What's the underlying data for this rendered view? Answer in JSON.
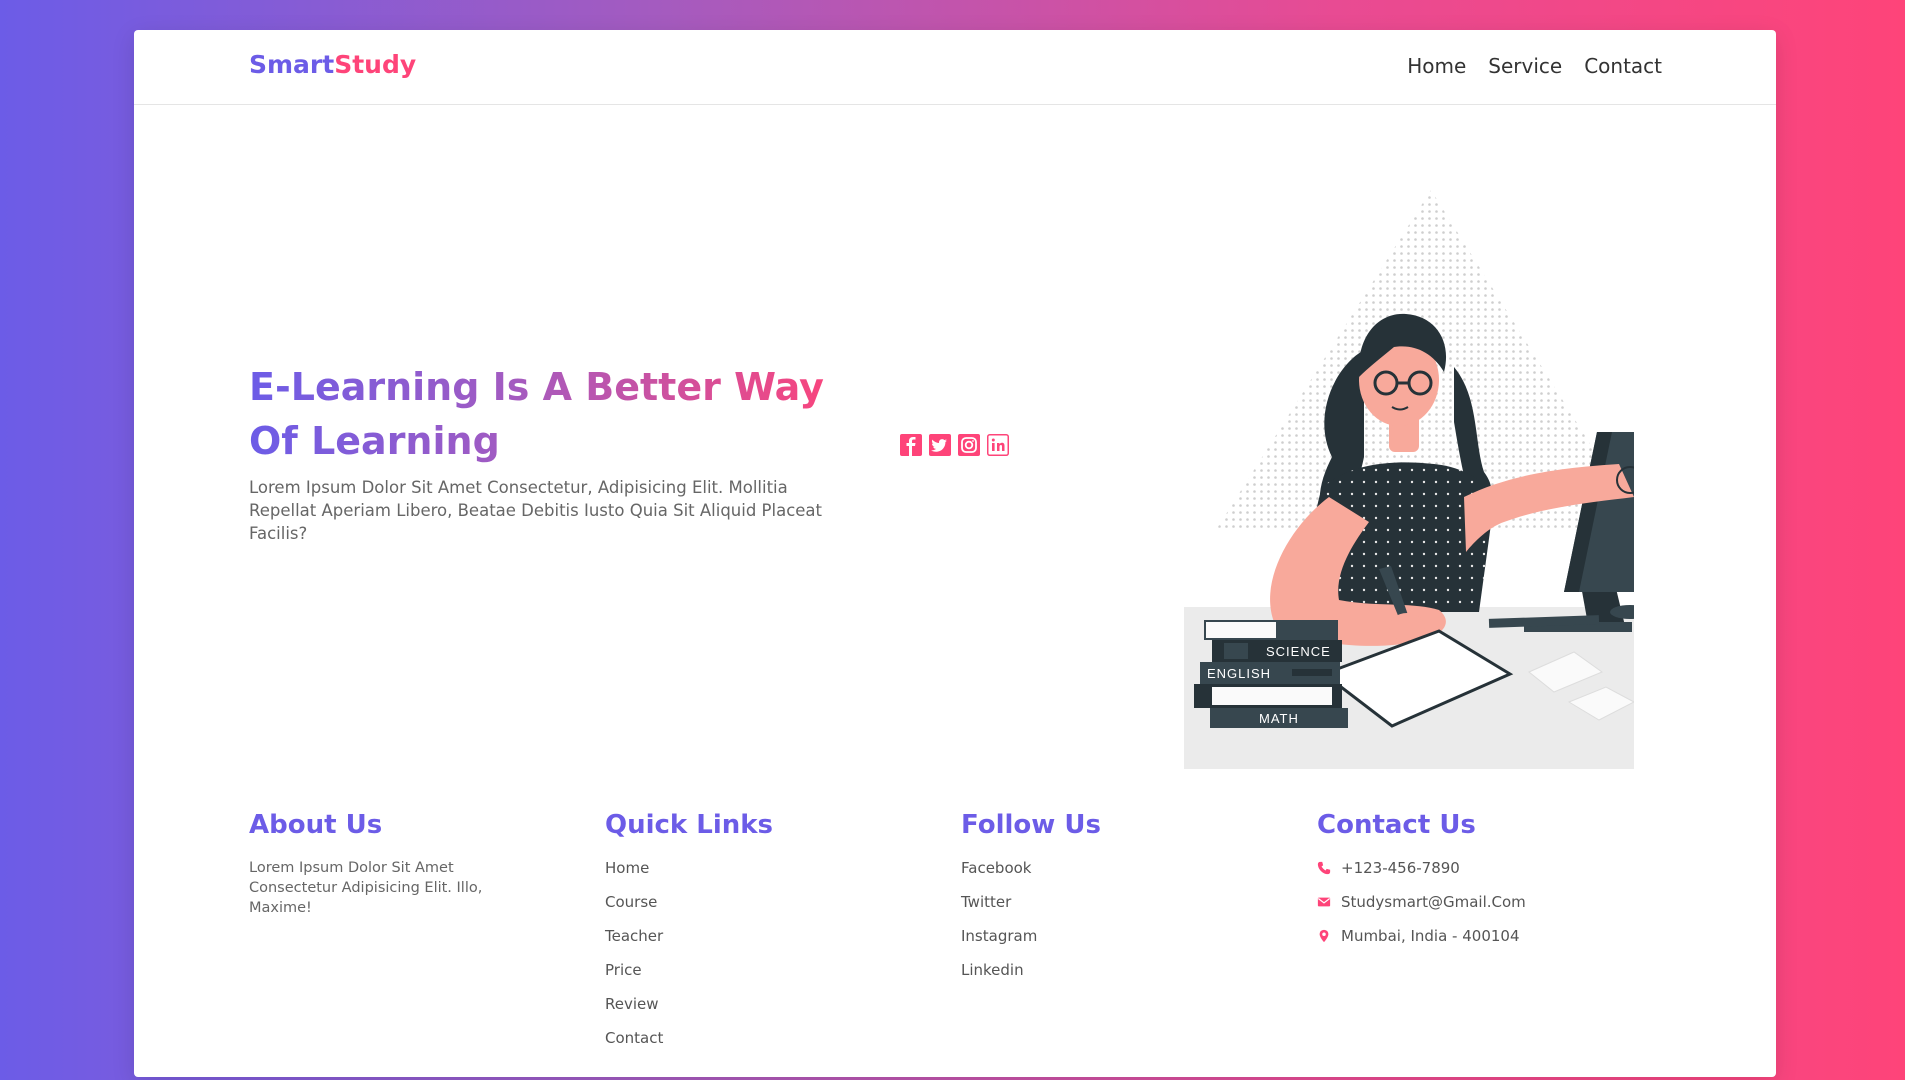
{
  "brand": {
    "part1": "Smart",
    "part2": "Study",
    "color1": "#6c5ce7",
    "color2": "#fe4479"
  },
  "nav": {
    "items": [
      "Home",
      "Service",
      "Contact"
    ]
  },
  "hero": {
    "title": "E-Learning Is A Better Way Of Learning",
    "description": "Lorem Ipsum Dolor Sit Amet Consectetur, Adipisicing Elit. Mollitia Repellat Aperiam Libero, Beatae Debitis Iusto Quia Sit Aliquid Placeat Facilis?",
    "social_icons": [
      "facebook-icon",
      "twitter-icon",
      "instagram-icon",
      "linkedin-icon"
    ],
    "illustration": {
      "book_labels": [
        "SCIENCE",
        "ENGLISH",
        "MATH"
      ]
    }
  },
  "footer": {
    "about": {
      "title": "About Us",
      "text": "Lorem Ipsum Dolor Sit Amet Consectetur Adipisicing Elit. Illo, Maxime!"
    },
    "quick_links": {
      "title": "Quick Links",
      "items": [
        "Home",
        "Course",
        "Teacher",
        "Price",
        "Review",
        "Contact"
      ]
    },
    "follow": {
      "title": "Follow Us",
      "items": [
        "Facebook",
        "Twitter",
        "Instagram",
        "Linkedin"
      ]
    },
    "contact": {
      "title": "Contact Us",
      "phone": "+123-456-7890",
      "email": "Studysmart@Gmail.Com",
      "address": "Mumbai, India - 400104",
      "icons": [
        "phone-icon",
        "envelope-icon",
        "map-pin-icon"
      ]
    }
  },
  "colors": {
    "accent": "#fe4479",
    "primary": "#6c5ce7",
    "text_gray": "#666666",
    "illustration_dark": "#37474f",
    "illustration_skin": "#f8a99b"
  }
}
